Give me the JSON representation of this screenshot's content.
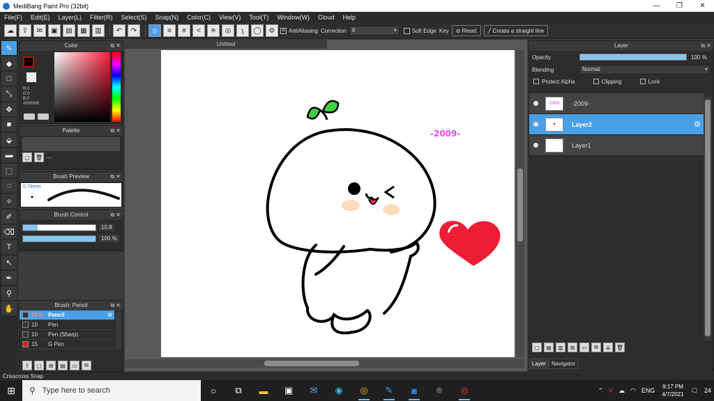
{
  "window": {
    "title": "MediBang Paint Pro (32bit)",
    "minimize": "—",
    "maximize": "❐",
    "close": "✕"
  },
  "menu": [
    "File(F)",
    "Edit(E)",
    "Layer(L)",
    "Filter(R)",
    "Select(S)",
    "Snap(N)",
    "Color(C)",
    "View(V)",
    "Tool(T)",
    "Window(W)",
    "Cloud",
    "Help"
  ],
  "toolbar": {
    "antialiasing": "AntiAliasing",
    "correction_label": "Correction",
    "correction_value": "8",
    "soft_edge": "Soft Edge",
    "key_label": "Key",
    "reset_label": "Reset",
    "straight_line_label": "Create a straight line"
  },
  "color_panel": {
    "title": "Color",
    "rgb": [
      "R:0",
      "G:0",
      "B:0",
      "#000000"
    ],
    "fg_color": "#000000"
  },
  "palette_panel": {
    "title": "Palette",
    "dash": "---"
  },
  "brush_preview": {
    "title": "Brush Preview",
    "size": "0.79mm"
  },
  "brush_control": {
    "title": "Brush Control",
    "size_value": "10.9",
    "size_fill": 0.2,
    "opacity_value": "100 %",
    "opacity_fill": 1.0
  },
  "brush_list": {
    "title": "Brush: Pencil",
    "items": [
      {
        "size": "10.9",
        "name": "Pencil",
        "color": "#333333"
      },
      {
        "size": "10",
        "name": "Pen",
        "color": "#333333"
      },
      {
        "size": "10",
        "name": "Pen (Sharp)",
        "color": "#333333"
      },
      {
        "size": "15",
        "name": "G Pen",
        "color": "#e02020"
      }
    ]
  },
  "canvas": {
    "doc_title": "Untitled",
    "art_label": "-2009-",
    "label_color": "#ee44ee",
    "heart_color": "#ee1c35",
    "leaf_color": "#3fcf3f"
  },
  "layer_panel": {
    "title": "Layer",
    "opacity_label": "Opacity",
    "opacity_value": "100 %",
    "blending_label": "Blending",
    "blending_value": "Normal",
    "protect_alpha": "Protect Alpha",
    "clipping": "Clipping",
    "lock": "Lock",
    "layers": [
      {
        "name": "-2009-",
        "thumb": "-2009-"
      },
      {
        "name": "Layer2",
        "thumb": "♥"
      },
      {
        "name": "Layer1",
        "thumb": ""
      }
    ],
    "tabs": [
      "Layer",
      "Navigator"
    ]
  },
  "status": {
    "text": "Crisscross Snap"
  },
  "taskbar": {
    "search_placeholder": "Type here to search",
    "lang": "ENG",
    "time": "9:17 PM",
    "date": "4/7/2021",
    "notifications": "24"
  }
}
